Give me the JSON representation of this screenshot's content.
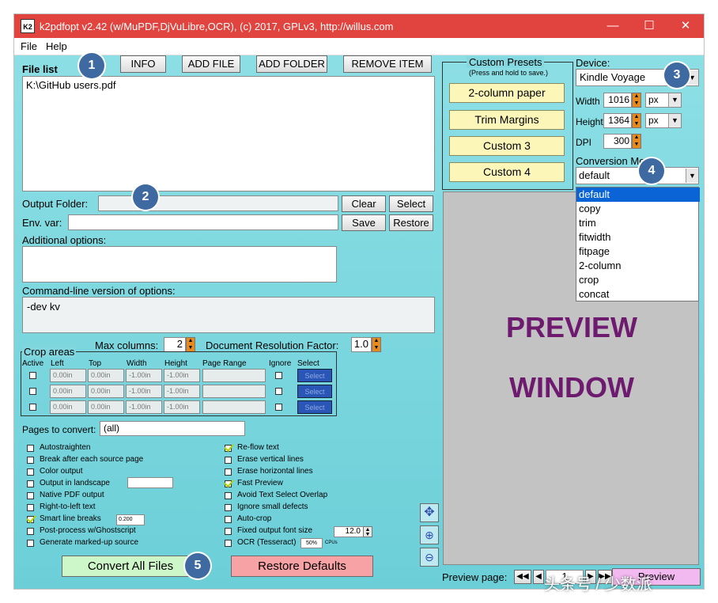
{
  "window": {
    "title": "k2pdfopt v2.42 (w/MuPDF,DjVuLibre,OCR), (c) 2017, GPLv3, http://willus.com",
    "icon_text": "K2"
  },
  "menu": {
    "file": "File",
    "help": "Help"
  },
  "file_list": {
    "label": "File list",
    "info": "INFO",
    "add_file": "ADD FILE",
    "add_folder": "ADD FOLDER",
    "remove_item": "REMOVE ITEM",
    "items": [
      "K:\\GitHub users.pdf"
    ]
  },
  "output": {
    "folder_label": "Output Folder:",
    "folder_value": "",
    "clear": "Clear",
    "select": "Select",
    "env_label": "Env. var:",
    "env_value": "",
    "save": "Save",
    "restore": "Restore",
    "additional_label": "Additional options:",
    "cmdline_label": "Command-line version of options:",
    "cmdline_value": "-dev kv"
  },
  "max_columns": {
    "label": "Max columns:",
    "value": "2"
  },
  "doc_res": {
    "label": "Document Resolution Factor:",
    "value": "1.0"
  },
  "crop": {
    "title": "Crop areas",
    "headers": {
      "active": "Active",
      "left": "Left",
      "top": "Top",
      "width": "Width",
      "height": "Height",
      "range": "Page Range",
      "ignore": "Ignore",
      "select": "Select"
    },
    "rows": [
      {
        "left": "0.00in",
        "top": "0.00in",
        "width": "-1.00in",
        "height": "-1.00in",
        "select": "Select"
      },
      {
        "left": "0.00in",
        "top": "0.00in",
        "width": "-1.00in",
        "height": "-1.00in",
        "select": "Select"
      },
      {
        "left": "0.00in",
        "top": "0.00in",
        "width": "-1.00in",
        "height": "-1.00in",
        "select": "Select"
      }
    ]
  },
  "pages": {
    "label": "Pages to convert:",
    "value": "(all)"
  },
  "options_left": [
    {
      "label": "Autostraighten",
      "checked": false
    },
    {
      "label": "Break after each source page",
      "checked": false
    },
    {
      "label": "Color output",
      "checked": false
    },
    {
      "label": "Output in landscape",
      "checked": false
    },
    {
      "label": "Native PDF output",
      "checked": false
    },
    {
      "label": "Right-to-left text",
      "checked": false
    },
    {
      "label": "Smart line breaks",
      "checked": true
    },
    {
      "label": "Post-process w/Ghostscript",
      "checked": false
    },
    {
      "label": "Generate marked-up source",
      "checked": false
    }
  ],
  "smart_break_value": "0.200",
  "options_right": [
    {
      "label": "Re-flow text",
      "checked": true
    },
    {
      "label": "Erase vertical lines",
      "checked": false
    },
    {
      "label": "Erase horizontal lines",
      "checked": false
    },
    {
      "label": "Fast Preview",
      "checked": true
    },
    {
      "label": "Avoid Text Select Overlap",
      "checked": false
    },
    {
      "label": "Ignore small defects",
      "checked": false
    },
    {
      "label": "Auto-crop",
      "checked": false
    },
    {
      "label": "Fixed output font size",
      "checked": false
    },
    {
      "label": "OCR (Tesseract)",
      "checked": false
    }
  ],
  "font_size_value": "12.0",
  "ocr": {
    "percent": "50%",
    "cpus": "CPUs"
  },
  "buttons": {
    "convert": "Convert All Files",
    "restore_defaults": "Restore Defaults"
  },
  "presets": {
    "title": "Custom Presets",
    "subtitle": "(Press and hold to save.)",
    "items": [
      "2-column paper",
      "Trim Margins",
      "Custom 3",
      "Custom 4"
    ]
  },
  "device": {
    "label": "Device:",
    "value": "Kindle Voyage",
    "width_label": "Width",
    "width_value": "1016",
    "width_unit": "px",
    "height_label": "Height",
    "height_value": "1364",
    "height_unit": "px",
    "dpi_label": "DPI",
    "dpi_value": "300"
  },
  "conversion": {
    "label": "Conversion Mode:",
    "value": "default",
    "options": [
      "default",
      "copy",
      "trim",
      "fitwidth",
      "fitpage",
      "2-column",
      "crop",
      "concat"
    ]
  },
  "preview": {
    "line1": "PREVIEW",
    "line2": "WINDOW",
    "page_label": "Preview page:",
    "page_value": "1",
    "button": "Preview"
  },
  "badges": [
    "1",
    "2",
    "3",
    "4",
    "5"
  ],
  "watermark": "头条号 / 少数派",
  "colors": {
    "titlebar": "#e1433e",
    "panel": "#7fd8df",
    "preview_bg": "#c3c3c3",
    "preview_text": "#6e1a6e",
    "badge": "#3f6aa1"
  }
}
